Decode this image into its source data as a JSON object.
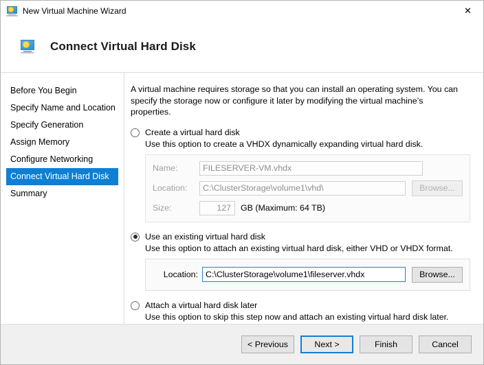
{
  "window": {
    "title": "New Virtual Machine Wizard",
    "icon": "virtual-machine-icon",
    "close_label": "✕"
  },
  "header": {
    "title": "Connect Virtual Hard Disk",
    "icon": "virtual-machine-icon"
  },
  "sidebar": {
    "items": [
      {
        "label": "Before You Begin",
        "selected": false
      },
      {
        "label": "Specify Name and Location",
        "selected": false
      },
      {
        "label": "Specify Generation",
        "selected": false
      },
      {
        "label": "Assign Memory",
        "selected": false
      },
      {
        "label": "Configure Networking",
        "selected": false
      },
      {
        "label": "Connect Virtual Hard Disk",
        "selected": true
      },
      {
        "label": "Summary",
        "selected": false
      }
    ],
    "selected_index": 5,
    "highlight_color": "#0f7fd4"
  },
  "main": {
    "intro": "A virtual machine requires storage so that you can install an operating system. You can specify the storage now or configure it later by modifying the virtual machine’s properties.",
    "options": [
      {
        "id": "create-new",
        "label": "Create a virtual hard disk",
        "description": "Use this option to create a VHDX dynamically expanding virtual hard disk.",
        "selected": false,
        "enabled": false
      },
      {
        "id": "use-existing",
        "label": "Use an existing virtual hard disk",
        "description": "Use this option to attach an existing virtual hard disk, either VHD or VHDX format.",
        "selected": true,
        "enabled": true
      },
      {
        "id": "attach-later",
        "label": "Attach a virtual hard disk later",
        "description": "Use this option to skip this step now and attach an existing virtual hard disk later.",
        "selected": false,
        "enabled": false
      }
    ],
    "create_group": {
      "name_label": "Name:",
      "name_value": "FILESERVER-VM.vhdx",
      "location_label": "Location:",
      "location_value": "C:\\ClusterStorage\\volume1\\vhd\\",
      "browse_label": "Browse...",
      "size_label": "Size:",
      "size_value": "127",
      "size_suffix": "GB (Maximum: 64 TB)"
    },
    "existing_group": {
      "location_label": "Location:",
      "location_value": "C:\\ClusterStorage\\volume1\\fileserver.vhdx",
      "browse_label": "Browse..."
    }
  },
  "footer": {
    "buttons": [
      {
        "label": "< Previous",
        "focused": false
      },
      {
        "label": "Next >",
        "focused": true
      },
      {
        "label": "Finish",
        "focused": false
      },
      {
        "label": "Cancel",
        "focused": false
      }
    ],
    "focus_color": "#0f7fd4"
  }
}
